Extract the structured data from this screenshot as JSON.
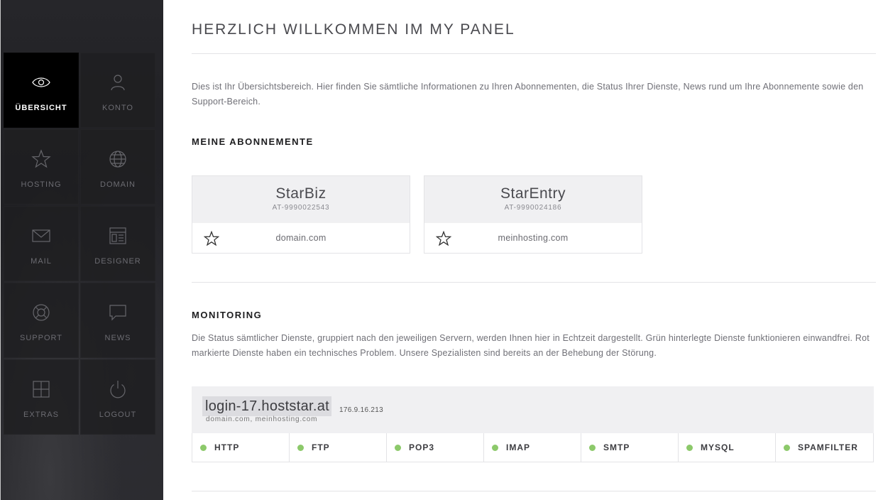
{
  "sidebar": {
    "items": [
      {
        "label": "ÜBERSICHT",
        "icon": "eye-icon",
        "active": true
      },
      {
        "label": "KONTO",
        "icon": "user-icon",
        "active": false
      },
      {
        "label": "HOSTING",
        "icon": "star-icon",
        "active": false
      },
      {
        "label": "DOMAIN",
        "icon": "globe-icon",
        "active": false
      },
      {
        "label": "MAIL",
        "icon": "envelope-icon",
        "active": false
      },
      {
        "label": "DESIGNER",
        "icon": "layout-icon",
        "active": false
      },
      {
        "label": "SUPPORT",
        "icon": "lifebuoy-icon",
        "active": false
      },
      {
        "label": "NEWS",
        "icon": "speech-bubble-icon",
        "active": false
      },
      {
        "label": "EXTRAS",
        "icon": "plus-box-icon",
        "active": false
      },
      {
        "label": "LOGOUT",
        "icon": "power-icon",
        "active": false
      }
    ]
  },
  "main": {
    "title": "HERZLICH WILLKOMMEN IM MY PANEL",
    "intro": "Dies ist Ihr Übersichtsbereich. Hier finden Sie sämtliche Informationen zu Ihren Abonnementen, die Status Ihrer Dienste, News rund um Ihre Abonnemente sowie den Support-Bereich.",
    "subscriptions_title": "MEINE ABONNEMENTE",
    "subscriptions": [
      {
        "plan": "StarBiz",
        "code": "AT-9990022543",
        "domain": "domain.com"
      },
      {
        "plan": "StarEntry",
        "code": "AT-9990024186",
        "domain": "meinhosting.com"
      }
    ],
    "monitoring_title": "MONITORING",
    "monitoring_text": "Die Status sämtlicher Dienste, gruppiert nach den jeweiligen Servern, werden Ihnen hier in Echtzeit dargestellt. Grün hinterlegte Dienste funktionieren einwandfrei. Rot markierte Dienste haben ein technisches Problem. Unsere Spezialisten sind bereits an der Behebung der Störung.",
    "server": {
      "host": "login-17.hoststar.at",
      "ip": "176.9.16.213",
      "domains": "domain.com, meinhosting.com",
      "services": [
        {
          "name": "HTTP",
          "status": "ok"
        },
        {
          "name": "FTP",
          "status": "ok"
        },
        {
          "name": "POP3",
          "status": "ok"
        },
        {
          "name": "IMAP",
          "status": "ok"
        },
        {
          "name": "SMTP",
          "status": "ok"
        },
        {
          "name": "MYSQL",
          "status": "ok"
        },
        {
          "name": "SPAMFILTER",
          "status": "ok"
        }
      ]
    }
  },
  "colors": {
    "status_ok": "#8cc96a",
    "status_error": "#d9534f",
    "active_tile": "#000000"
  }
}
